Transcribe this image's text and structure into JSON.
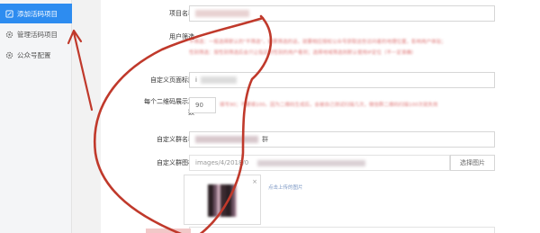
{
  "sidebar": {
    "items": [
      {
        "label": "添加活码项目",
        "icon": "edit-icon",
        "active": true
      },
      {
        "label": "管理活码项目",
        "icon": "gear-icon",
        "active": false
      },
      {
        "label": "公众号配置",
        "icon": "gear-icon",
        "active": false
      }
    ]
  },
  "form": {
    "project_name_label": "项目名称",
    "project_name_value": "",
    "user_filter_label": "用户筛选",
    "user_filter_hint_line1": "不筛选：一般选择默认的\"不筛选\"，如果筛选的话，就要相应授权公众号获取这些访问者的地理位置，影响用户体验；",
    "user_filter_hint_line2": "性别筛选：按性别筛选后会只让指定的性别的用户看到；选择地域筛选则默认使用IP定位（不一定准确）",
    "page_title_label": "自定义页面标题",
    "page_title_value": "i",
    "qr_count_label_line1": "每个二维码展示次",
    "qr_count_label_line2": "数",
    "qr_count_value": "90",
    "qr_count_hint": "填写90；不要填100。因为二维码生成后，会被自己测试扫描几次，微信群二维码扫描100次就失效",
    "group_name_label": "自定义群名称",
    "group_name_value": "群",
    "group_icon_label": "自定义群图标",
    "group_icon_path": "images/4/2018/0",
    "choose_image_label": "选择图片",
    "remove_hint": "点击上传的图片"
  },
  "colors": {
    "accent": "#2d8cf0",
    "annotation": "#c0392b"
  }
}
